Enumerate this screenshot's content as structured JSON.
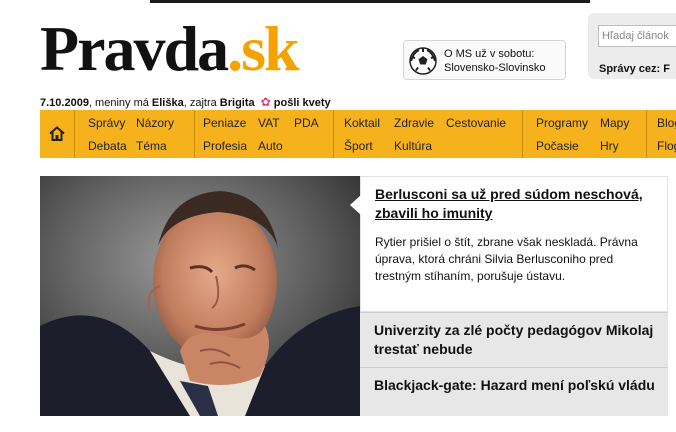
{
  "logo": {
    "name": "Pravda",
    "dot": ".",
    "tld": "sk"
  },
  "promo": {
    "text": "O MS už v sobotu: Slovensko-Slovinsko"
  },
  "search": {
    "placeholder": "Hľadaj článok",
    "label": "Správy cez: F"
  },
  "dateline": {
    "date": "7.10.2009",
    "mid1": ", meniny má ",
    "name1": "Eliška",
    "mid2": ", zajtra ",
    "name2": "Brigita",
    "flowers": "pošli kvety"
  },
  "nav": {
    "groups": [
      {
        "items": [
          "Správy",
          "Názory",
          "Debata",
          "Téma"
        ]
      },
      {
        "items": [
          "Peniaze",
          "VAT",
          "PDA",
          "Profesia",
          "Auto"
        ]
      },
      {
        "items": [
          "Koktail",
          "Zdravie",
          "Cestovanie",
          "Šport",
          "Kultúra"
        ]
      },
      {
        "items": [
          "Programy",
          "Mapy",
          "Počasie",
          "Hry"
        ]
      },
      {
        "items": [
          "Blogy",
          "Flog"
        ]
      }
    ]
  },
  "stories": {
    "main": {
      "title": "Berlusconi sa už pred súdom neschová, zbavili ho imunity",
      "lead": "Rytier prišiel o štít, zbrane však neskladá. Právna úprava, ktorá chráni Silvia Berlusconiho pred trestným stíhaním, porušuje ústavu."
    },
    "second": {
      "title": "Univerzity za zlé počty pedagógov Mikolaj trestať nebude"
    },
    "third": {
      "title": "Blackjack-gate: Hazard mení poľskú vládu"
    }
  }
}
